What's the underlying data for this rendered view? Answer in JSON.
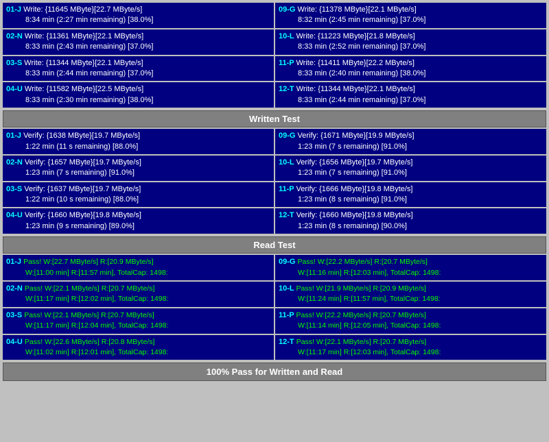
{
  "sections": {
    "written_test": {
      "header": "Written Test",
      "left": [
        {
          "id": "01-J",
          "line1": "Write: {11645 MByte}[22.7 MByte/s]",
          "line2": "8:34 min (2:27 min remaining)  [38.0%]"
        },
        {
          "id": "02-N",
          "line1": "Write: {11361 MByte}[22.1 MByte/s]",
          "line2": "8:33 min (2:43 min remaining)  [37.0%]"
        },
        {
          "id": "03-S",
          "line1": "Write: {11344 MByte}[22.1 MByte/s]",
          "line2": "8:33 min (2:44 min remaining)  [37.0%]"
        },
        {
          "id": "04-U",
          "line1": "Write: {11582 MByte}[22.5 MByte/s]",
          "line2": "8:33 min (2:30 min remaining)  [38.0%]"
        }
      ],
      "right": [
        {
          "id": "09-G",
          "line1": "Write: {11378 MByte}[22.1 MByte/s]",
          "line2": "8:32 min (2:45 min remaining)  [37.0%]"
        },
        {
          "id": "10-L",
          "line1": "Write: {11223 MByte}[21.8 MByte/s]",
          "line2": "8:33 min (2:52 min remaining)  [37.0%]"
        },
        {
          "id": "11-P",
          "line1": "Write: {11411 MByte}[22.2 MByte/s]",
          "line2": "8:33 min (2:40 min remaining)  [38.0%]"
        },
        {
          "id": "12-T",
          "line1": "Write: {11344 MByte}[22.1 MByte/s]",
          "line2": "8:33 min (2:44 min remaining)  [37.0%]"
        }
      ]
    },
    "verify_test": {
      "left": [
        {
          "id": "01-J",
          "line1": "Verify: {1638 MByte}[19.7 MByte/s]",
          "line2": "1:22 min (11 s remaining)   [88.0%]"
        },
        {
          "id": "02-N",
          "line1": "Verify: {1657 MByte}[19.7 MByte/s]",
          "line2": "1:23 min (7 s remaining)   [91.0%]"
        },
        {
          "id": "03-S",
          "line1": "Verify: {1637 MByte}[19.7 MByte/s]",
          "line2": "1:22 min (10 s remaining)   [88.0%]"
        },
        {
          "id": "04-U",
          "line1": "Verify: {1660 MByte}[19.8 MByte/s]",
          "line2": "1:23 min (9 s remaining)   [89.0%]"
        }
      ],
      "right": [
        {
          "id": "09-G",
          "line1": "Verify: {1671 MByte}[19.9 MByte/s]",
          "line2": "1:23 min (7 s remaining)   [91.0%]"
        },
        {
          "id": "10-L",
          "line1": "Verify: {1656 MByte}[19.7 MByte/s]",
          "line2": "1:23 min (7 s remaining)   [91.0%]"
        },
        {
          "id": "11-P",
          "line1": "Verify: {1666 MByte}[19.8 MByte/s]",
          "line2": "1:23 min (8 s remaining)   [91.0%]"
        },
        {
          "id": "12-T",
          "line1": "Verify: {1660 MByte}[19.8 MByte/s]",
          "line2": "1:23 min (8 s remaining)   [90.0%]"
        }
      ]
    },
    "read_test": {
      "header": "Read Test",
      "left": [
        {
          "id": "01-J",
          "line1": "Pass! W:[22.7 MByte/s] R:[20.9 MByte/s]",
          "line2": "W:[11:00 min] R:[11:57 min], TotalCap: 1498:"
        },
        {
          "id": "02-N",
          "line1": "Pass! W:[22.1 MByte/s] R:[20.7 MByte/s]",
          "line2": "W:[11:17 min] R:[12:02 min], TotalCap: 1498:"
        },
        {
          "id": "03-S",
          "line1": "Pass! W:[22.1 MByte/s] R:[20.7 MByte/s]",
          "line2": "W:[11:17 min] R:[12:04 min], TotalCap: 1498:"
        },
        {
          "id": "04-U",
          "line1": "Pass! W:[22.6 MByte/s] R:[20.8 MByte/s]",
          "line2": "W:[11:02 min] R:[12:01 min], TotalCap: 1498:"
        }
      ],
      "right": [
        {
          "id": "09-G",
          "line1": "Pass! W:[22.2 MByte/s] R:[20.7 MByte/s]",
          "line2": "W:[11:16 min] R:[12:03 min], TotalCap: 1498:"
        },
        {
          "id": "10-L",
          "line1": "Pass! W:[21.9 MByte/s] R:[20.9 MByte/s]",
          "line2": "W:[11:24 min] R:[11:57 min], TotalCap: 1498:"
        },
        {
          "id": "11-P",
          "line1": "Pass! W:[22.2 MByte/s] R:[20.7 MByte/s]",
          "line2": "W:[11:14 min] R:[12:05 min], TotalCap: 1498:"
        },
        {
          "id": "12-T",
          "line1": "Pass! W:[22.1 MByte/s] R:[20.7 MByte/s]",
          "line2": "W:[11:17 min] R:[12:03 min], TotalCap: 1498:"
        }
      ]
    }
  },
  "footer": "100% Pass for Written and Read"
}
